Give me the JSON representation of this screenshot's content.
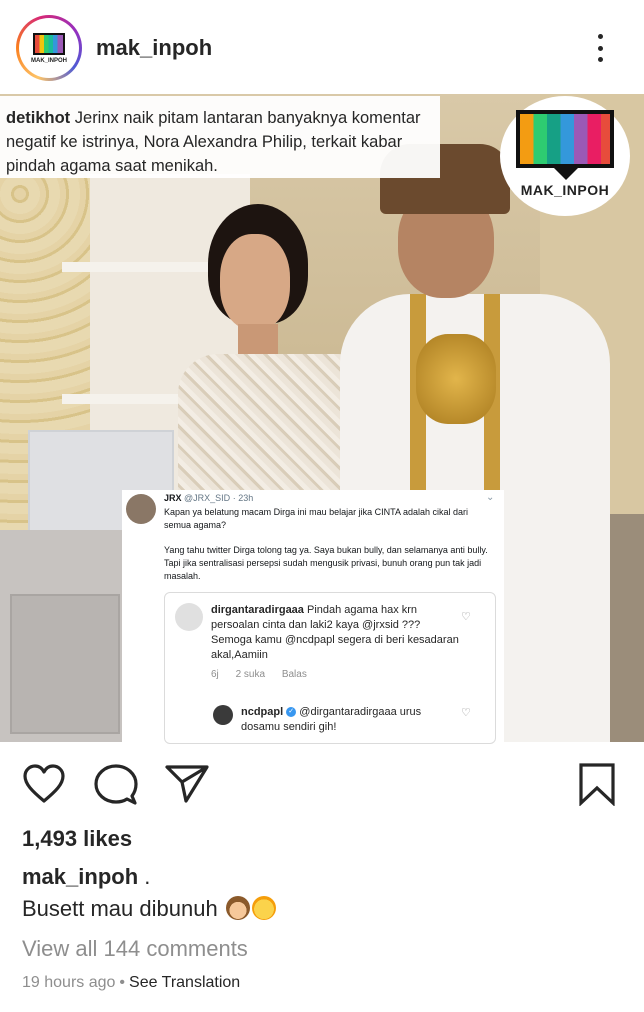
{
  "post": {
    "username": "mak_inpoh",
    "avatar_logo_text": "MAK_INPOH"
  },
  "image": {
    "caption_handle": "detikhot",
    "caption_text": "Jerinx naik pitam lantaran banyaknya komentar negatif ke istrinya, Nora Alexandra Philip, terkait kabar pindah agama saat menikah.",
    "logo_text": "MAK_INPOH",
    "tweet": {
      "name": "JRX",
      "handle": "@JRX_SID",
      "age": "23h",
      "paragraph1": "Kapan ya belatung macam Dirga ini mau belajar jika CINTA adalah cikal dari semua agama?",
      "paragraph2": "Yang tahu twitter Dirga tolong tag ya. Saya bukan bully, dan selamanya anti bully. Tapi jika sentralisasi persepsi sudah mengusik privasi, bunuh orang pun tak jadi masalah."
    },
    "ig_comment": {
      "user": "dirgantaradirgaaa",
      "text": "Pindah agama hax krn persoalan cinta dan laki2 kaya @jrxsid ??? Semoga kamu @ncdpapl segera di beri kesadaran akal,Aamiin",
      "time": "6j",
      "likes": "2 suka",
      "reply": "Balas"
    },
    "ig_reply": {
      "user": "ncdpapl",
      "text": "@dirgantaradirgaaa urus dosamu sendiri gih!"
    }
  },
  "actions": {
    "like_icon": "heart-icon",
    "comment_icon": "comment-icon",
    "share_icon": "paper-plane-icon",
    "save_icon": "bookmark-icon"
  },
  "likes": "1,493 likes",
  "caption": {
    "user": "mak_inpoh",
    "suffix": " .",
    "body": "Busett mau dibunuh"
  },
  "view_all": "View all 144 comments",
  "timestamp": "19 hours ago",
  "dot": "•",
  "see_translation": "See Translation"
}
